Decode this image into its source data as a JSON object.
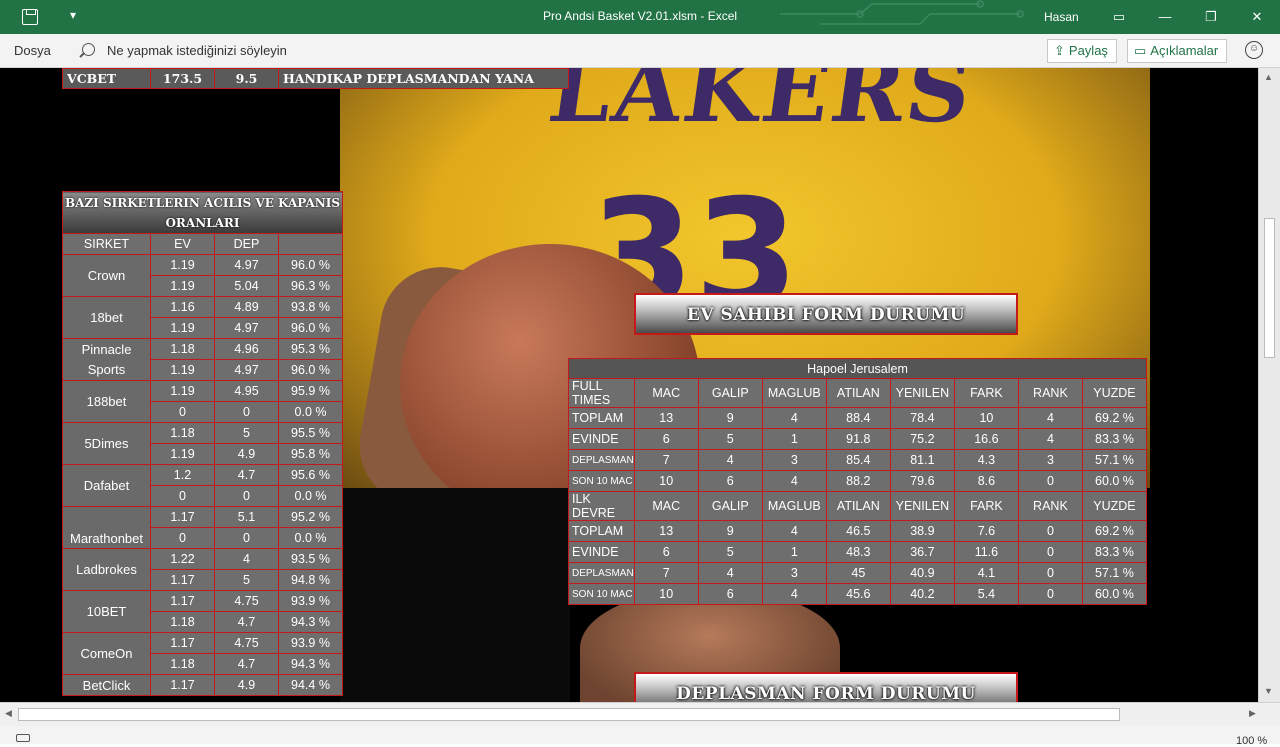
{
  "window": {
    "title": "Pro Andsi Basket V2.01.xlsm  -  Excel",
    "user": "Hasan",
    "qat_dropdown": "▾",
    "restore_icon": "▭",
    "minimize_icon": "—",
    "maximize_icon": "❐",
    "close_icon": "✕"
  },
  "ribbon": {
    "file_tab": "Dosya",
    "tell_me": "Ne yapmak istediğinizi söyleyin",
    "share": "Paylaş",
    "comments": "Açıklamalar"
  },
  "top_row": {
    "company": "VCBET",
    "total": "173.5",
    "handicap": "9.5",
    "note": "HANDIKAP DEPLASMANDAN YANA"
  },
  "odds_table": {
    "title": "BAZI SIRKETLERIN ACILIS VE KAPANIS ORANLARI",
    "headers": [
      "SIRKET",
      "EV",
      "DEP",
      ""
    ],
    "companies": [
      {
        "name": "Crown",
        "rows": [
          [
            "1.19",
            "4.97",
            "96.0 %"
          ],
          [
            "1.19",
            "5.04",
            "96.3 %"
          ]
        ]
      },
      {
        "name": "18bet",
        "rows": [
          [
            "1.16",
            "4.89",
            "93.8 %"
          ],
          [
            "1.19",
            "4.97",
            "96.0 %"
          ]
        ]
      },
      {
        "name": "Pinnacle Sports",
        "rows": [
          [
            "1.18",
            "4.96",
            "95.3 %"
          ],
          [
            "1.19",
            "4.97",
            "96.0 %"
          ]
        ]
      },
      {
        "name": "188bet",
        "rows": [
          [
            "1.19",
            "4.95",
            "95.9 %"
          ],
          [
            "0",
            "0",
            "0.0 %"
          ]
        ]
      },
      {
        "name": "5Dimes",
        "rows": [
          [
            "1.18",
            "5",
            "95.5 %"
          ],
          [
            "1.19",
            "4.9",
            "95.8 %"
          ]
        ]
      },
      {
        "name": "Dafabet",
        "rows": [
          [
            "1.2",
            "4.7",
            "95.6 %"
          ],
          [
            "0",
            "0",
            "0.0 %"
          ]
        ]
      },
      {
        "name": "Marathonbet",
        "rows": [
          [
            "1.17",
            "5.1",
            "95.2 %"
          ],
          [
            "0",
            "0",
            "0.0 %"
          ]
        ]
      },
      {
        "name": "Ladbrokes",
        "rows": [
          [
            "1.22",
            "4",
            "93.5 %"
          ],
          [
            "1.17",
            "5",
            "94.8 %"
          ]
        ]
      },
      {
        "name": "10BET",
        "rows": [
          [
            "1.17",
            "4.75",
            "93.9 %"
          ],
          [
            "1.18",
            "4.7",
            "94.3 %"
          ]
        ]
      },
      {
        "name": "ComeOn",
        "rows": [
          [
            "1.17",
            "4.75",
            "93.9 %"
          ],
          [
            "1.18",
            "4.7",
            "94.3 %"
          ]
        ]
      },
      {
        "name": "BetClick",
        "rows": [
          [
            "1.17",
            "4.9",
            "94.4 %"
          ]
        ]
      }
    ]
  },
  "home_form": {
    "banner": "EV SAHIBI FORM DURUMU",
    "team": "Hapoel Jerusalem",
    "sections": [
      {
        "header": [
          "FULL TIMES",
          "MAC",
          "GALIP",
          "MAGLUB",
          "ATILAN",
          "YENILEN",
          "FARK",
          "RANK",
          "YUZDE"
        ],
        "rows": [
          [
            "TOPLAM",
            "13",
            "9",
            "4",
            "88.4",
            "78.4",
            "10",
            "4",
            "69.2 %"
          ],
          [
            "EVINDE",
            "6",
            "5",
            "1",
            "91.8",
            "75.2",
            "16.6",
            "4",
            "83.3 %"
          ],
          [
            "DEPLASMAN",
            "7",
            "4",
            "3",
            "85.4",
            "81.1",
            "4.3",
            "3",
            "57.1 %"
          ],
          [
            "SON 10 MAC",
            "10",
            "6",
            "4",
            "88.2",
            "79.6",
            "8.6",
            "0",
            "60.0 %"
          ]
        ]
      },
      {
        "header": [
          "ILK DEVRE",
          "MAC",
          "GALIP",
          "MAGLUB",
          "ATILAN",
          "YENILEN",
          "FARK",
          "RANK",
          "YUZDE"
        ],
        "rows": [
          [
            "TOPLAM",
            "13",
            "9",
            "4",
            "46.5",
            "38.9",
            "7.6",
            "0",
            "69.2 %"
          ],
          [
            "EVINDE",
            "6",
            "5",
            "1",
            "48.3",
            "36.7",
            "11.6",
            "0",
            "83.3 %"
          ],
          [
            "DEPLASMAN",
            "7",
            "4",
            "3",
            "45",
            "40.9",
            "4.1",
            "0",
            "57.1 %"
          ],
          [
            "SON 10 MAC",
            "10",
            "6",
            "4",
            "45.6",
            "40.2",
            "5.4",
            "0",
            "60.0 %"
          ]
        ]
      }
    ]
  },
  "away_form": {
    "banner": "DEPLASMAN FORM DURUMU"
  },
  "photo_text": {
    "lettering": "LAKERS",
    "number": "33"
  },
  "status": {
    "zoom": "100 %"
  }
}
